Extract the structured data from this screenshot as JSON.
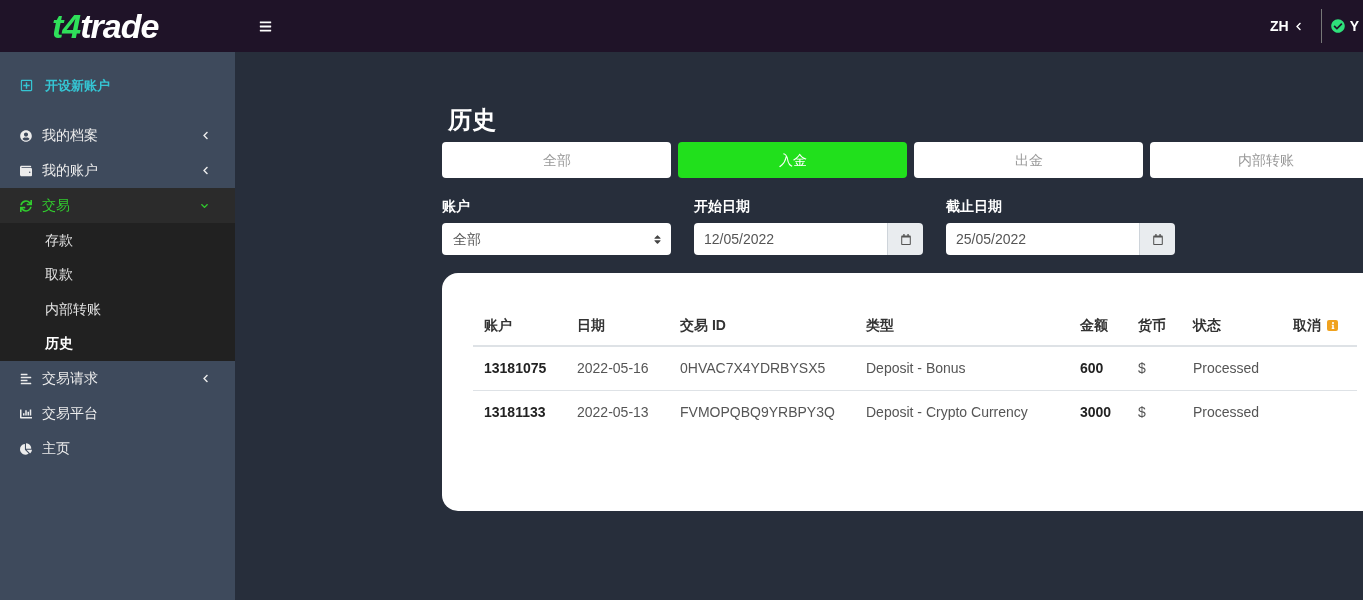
{
  "header": {
    "logo": {
      "accent": "t4",
      "text": "trade"
    },
    "language": "ZH",
    "user": "Y"
  },
  "sidebar": {
    "new_account": "开设新账户",
    "items": [
      {
        "label": "我的档案",
        "selected": false,
        "expanded": false
      },
      {
        "label": "我的账户",
        "selected": false,
        "expanded": false
      },
      {
        "label": "交易",
        "selected": true,
        "expanded": true,
        "children": [
          {
            "label": "存款",
            "selected": false
          },
          {
            "label": "取款",
            "selected": false
          },
          {
            "label": "内部转账",
            "selected": false
          },
          {
            "label": "历史",
            "selected": true
          }
        ]
      },
      {
        "label": "交易请求",
        "selected": false,
        "expanded": false
      },
      {
        "label": "交易平台",
        "selected": false
      },
      {
        "label": "主页",
        "selected": false
      }
    ]
  },
  "page": {
    "title": "历史"
  },
  "tabs": [
    {
      "label": "全部",
      "selected": false
    },
    {
      "label": "入金",
      "selected": true
    },
    {
      "label": "出金",
      "selected": false
    },
    {
      "label": "内部转账",
      "selected": false
    }
  ],
  "filters": {
    "account": {
      "label": "账户",
      "value": "全部"
    },
    "start_date": {
      "label": "开始日期",
      "value": "12/05/2022"
    },
    "end_date": {
      "label": "截止日期",
      "value": "25/05/2022"
    }
  },
  "table": {
    "columns": [
      "账户",
      "日期",
      "交易 ID",
      "类型",
      "金额",
      "货币",
      "状态",
      "取消"
    ],
    "rows": [
      {
        "account": "13181075",
        "date": "2022-05-16",
        "transaction_id": "0HVAC7X4YDRBYSX5",
        "type": "Deposit - Bonus",
        "amount": "600",
        "currency": "$",
        "status": "Processed"
      },
      {
        "account": "13181133",
        "date": "2022-05-13",
        "transaction_id": "FVMOPQBQ9YRBPY3Q",
        "type": "Deposit - Crypto Currency",
        "amount": "3000",
        "currency": "$",
        "status": "Processed"
      }
    ]
  }
}
